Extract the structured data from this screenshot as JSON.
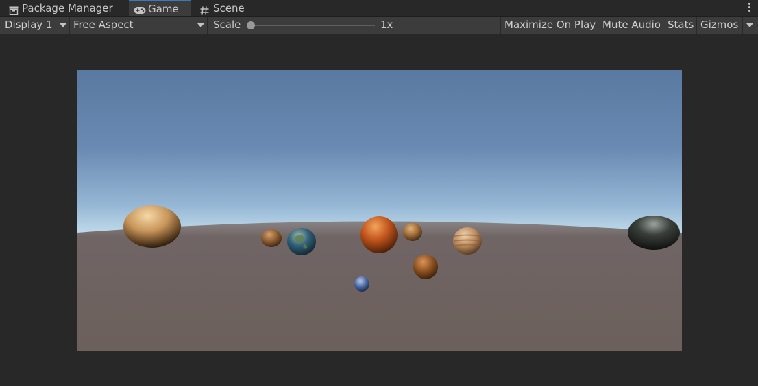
{
  "tabs": [
    {
      "label": "Package Manager",
      "icon": "package-icon",
      "active": false
    },
    {
      "label": "Game",
      "icon": "gamepad-icon",
      "active": true
    },
    {
      "label": "Scene",
      "icon": "grid-icon",
      "active": false
    }
  ],
  "toolbar": {
    "display": "Display 1",
    "aspect": "Free Aspect",
    "scale_label": "Scale",
    "scale_value": "1x",
    "maximize_on_play": "Maximize On Play",
    "mute_audio": "Mute Audio",
    "stats": "Stats",
    "gizmos": "Gizmos"
  },
  "colors": {
    "editor_bg": "#282828",
    "toolbar_bg": "#3c3c3c",
    "active_tab_accent": "#3a79bb",
    "sky_top": "#5b7aa1",
    "horizon": "#e6f6fb",
    "ground": "#6a5f5c"
  },
  "scene": {
    "objects": [
      {
        "name": "sun-sphere",
        "color": "#c8955a"
      },
      {
        "name": "mercury-sphere",
        "color": "#8a5a2e"
      },
      {
        "name": "earth-sphere",
        "color": "#2f5f77"
      },
      {
        "name": "mars-sphere",
        "color": "#c2561c"
      },
      {
        "name": "venus-sphere",
        "color": "#9e6a34"
      },
      {
        "name": "jupiter-sphere",
        "color": "#b98a5d"
      },
      {
        "name": "saturn-sphere",
        "color": "#8b4f1f"
      },
      {
        "name": "moon-sphere",
        "color": "#4a6aa3"
      },
      {
        "name": "dark-sphere",
        "color": "#3a3f3a"
      }
    ]
  }
}
